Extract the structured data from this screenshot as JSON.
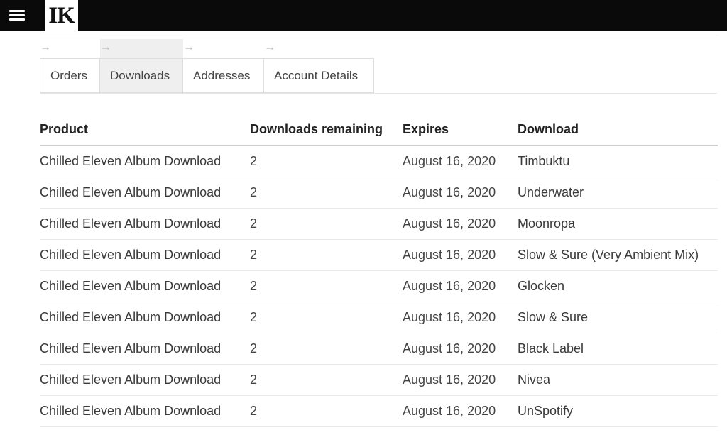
{
  "header": {
    "logo_text": "IK",
    "menu_icon": "hamburger-menu-icon"
  },
  "account_nav": {
    "arrow": "→",
    "tabs": [
      {
        "label": "Orders",
        "active": false
      },
      {
        "label": "Downloads",
        "active": true
      },
      {
        "label": "Addresses",
        "active": false
      },
      {
        "label": "Account Details",
        "active": false
      }
    ]
  },
  "downloads_table": {
    "columns": [
      "Product",
      "Downloads remaining",
      "Expires",
      "Download"
    ],
    "rows": [
      {
        "product": "Chilled Eleven Album Download",
        "remaining": "2",
        "expires": "August 16, 2020",
        "download": "Timbuktu"
      },
      {
        "product": "Chilled Eleven Album Download",
        "remaining": "2",
        "expires": "August 16, 2020",
        "download": "Underwater"
      },
      {
        "product": "Chilled Eleven Album Download",
        "remaining": "2",
        "expires": "August 16, 2020",
        "download": "Moonropa"
      },
      {
        "product": "Chilled Eleven Album Download",
        "remaining": "2",
        "expires": "August 16, 2020",
        "download": "Slow & Sure (Very Ambient Mix)"
      },
      {
        "product": "Chilled Eleven Album Download",
        "remaining": "2",
        "expires": "August 16, 2020",
        "download": "Glocken"
      },
      {
        "product": "Chilled Eleven Album Download",
        "remaining": "2",
        "expires": "August 16, 2020",
        "download": "Slow & Sure"
      },
      {
        "product": "Chilled Eleven Album Download",
        "remaining": "2",
        "expires": "August 16, 2020",
        "download": "Black Label"
      },
      {
        "product": "Chilled Eleven Album Download",
        "remaining": "2",
        "expires": "August 16, 2020",
        "download": "Nivea"
      },
      {
        "product": "Chilled Eleven Album Download",
        "remaining": "2",
        "expires": "August 16, 2020",
        "download": "UnSpotify"
      }
    ]
  }
}
